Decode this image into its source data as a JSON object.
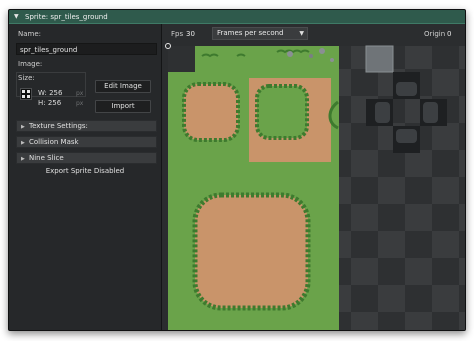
{
  "window": {
    "title": "Sprite: spr_tiles_ground"
  },
  "properties": {
    "name_label": "Name:",
    "name_value": "spr_tiles_ground",
    "image_label": "Image:",
    "size_label": "Size:",
    "width_text": "W: 256",
    "height_text": "H: 256",
    "px_unit": "px",
    "edit_image_label": "Edit Image",
    "import_label": "Import",
    "sections": [
      "Texture Settings:",
      "Collision Mask",
      "Nine Slice"
    ],
    "export_status": "Export Sprite Disabled"
  },
  "toolbar": {
    "fps_label": "Fps",
    "fps_value": "30",
    "speed_mode": "Frames per second",
    "origin_label": "Origin",
    "origin_value": "0"
  },
  "colors": {
    "titlebar": "#2f5a4c",
    "grass": "#6aa34a",
    "dirt": "#c9946a",
    "grass_edge": "#3e7a2e",
    "checker_dark": "#2e3032",
    "checker_light": "#3a3c3e"
  },
  "icons": {
    "collapse": "chevron-down-icon",
    "section": "chevron-right-icon",
    "dropdown": "caret-down-icon",
    "size": "sprite-size-icon"
  }
}
